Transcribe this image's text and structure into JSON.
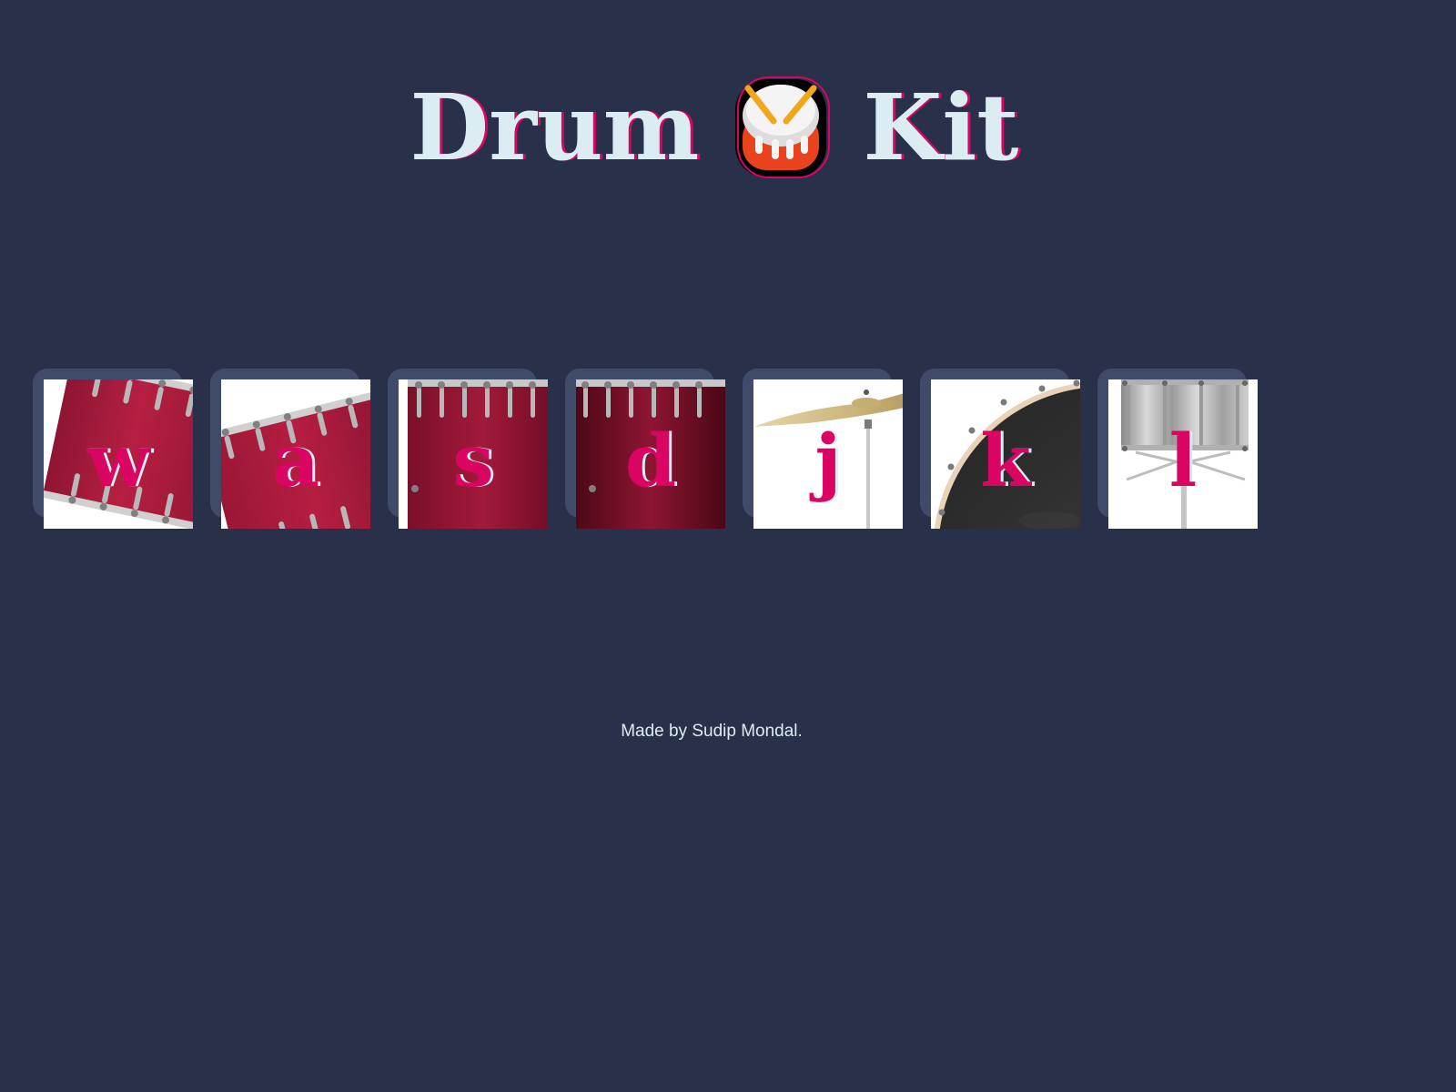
{
  "header": {
    "title_left": "Drum",
    "title_right": "Kit",
    "emoji_icon": "drum-emoji-icon"
  },
  "drums": [
    {
      "key": "w",
      "instrument_icon": "tom-drum-icon"
    },
    {
      "key": "a",
      "instrument_icon": "tom-drum-icon"
    },
    {
      "key": "s",
      "instrument_icon": "tom-drum-icon"
    },
    {
      "key": "d",
      "instrument_icon": "tom-drum-icon"
    },
    {
      "key": "j",
      "instrument_icon": "crash-cymbal-icon"
    },
    {
      "key": "k",
      "instrument_icon": "kick-drum-icon"
    },
    {
      "key": "l",
      "instrument_icon": "snare-drum-icon"
    }
  ],
  "footer": {
    "text": "Made by Sudip Mondal."
  },
  "colors": {
    "background": "#283149",
    "button_frame": "#404B69",
    "title_text": "#DBEDF3",
    "accent": "#DA0463"
  }
}
